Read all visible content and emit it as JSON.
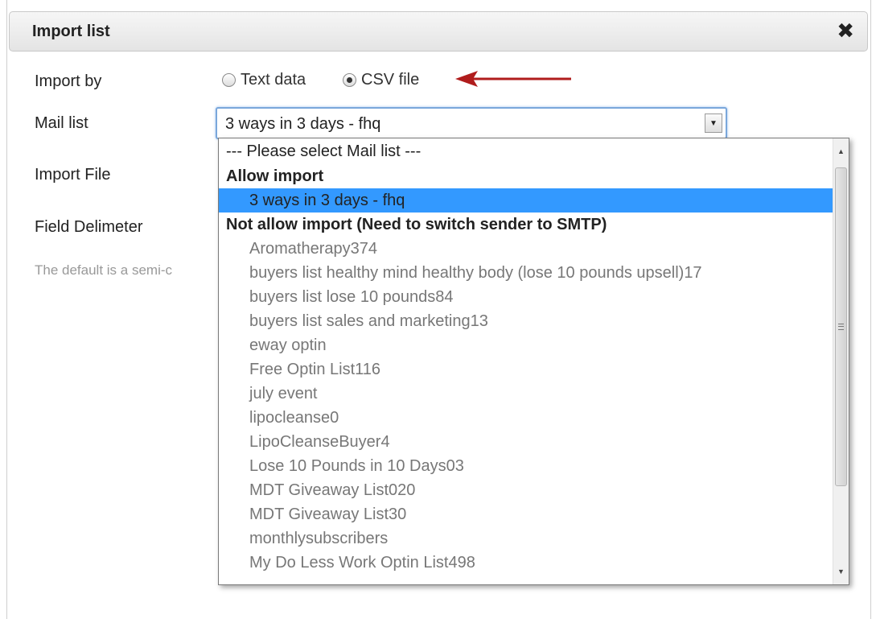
{
  "dialog": {
    "title": "Import list",
    "close_glyph": "✖"
  },
  "form": {
    "import_by_label": "Import by",
    "import_by_options": [
      {
        "label": "Text data",
        "checked": false
      },
      {
        "label": "CSV file",
        "checked": true
      }
    ],
    "mail_list_label": "Mail list",
    "mail_list_value": "3 ways in 3 days - fhq",
    "import_file_label": "Import File",
    "field_delimiter_label": "Field Delimeter",
    "hint_text": "The default is a semi-c"
  },
  "dropdown": {
    "placeholder": "--- Please select Mail list ---",
    "groups": [
      {
        "label": "Allow import",
        "items": [
          "3 ways in 3 days - fhq"
        ]
      },
      {
        "label": "Not allow import (Need to switch sender to SMTP)",
        "items": [
          "Aromatherapy374",
          "buyers list healthy mind healthy body (lose 10 pounds upsell)17",
          "buyers list lose 10 pounds84",
          "buyers list sales and marketing13",
          "eway optin",
          "Free Optin List116",
          "july event",
          "lipocleanse0",
          "LipoCleanseBuyer4",
          "Lose 10 Pounds in 10 Days03",
          "MDT Giveaway List020",
          "MDT Giveaway List30",
          "monthlysubscribers",
          "My Do Less Work Optin List498"
        ]
      }
    ],
    "selected": "3 ways in 3 days - fhq"
  },
  "colors": {
    "selection": "#3399ff",
    "arrow": "#b01c1c",
    "focus_border": "#7aa7db"
  },
  "icons": {
    "close": "close-icon",
    "arrow": "red-arrow-icon",
    "dropdown": "chevron-down-icon"
  }
}
